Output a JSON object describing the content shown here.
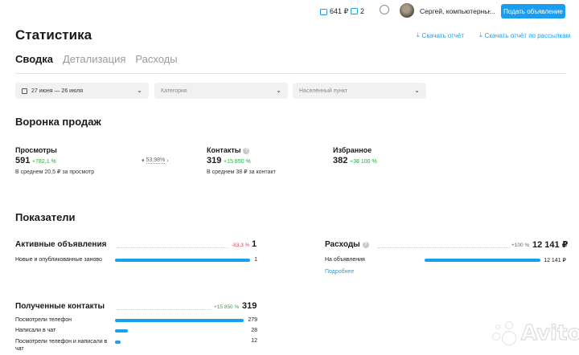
{
  "header": {
    "wallet_amount": "641 ₽",
    "messages_count": "2",
    "username": "Сергей, компьютерны...",
    "post_button": "Подать объявление",
    "icons": {
      "wallet": "wallet-icon",
      "messages": "chat-icon",
      "profile": "user-icon",
      "menu": "chevron-down-icon"
    }
  },
  "page": {
    "title": "Статистика",
    "download_report": "Скачать отчёт",
    "download_by_mailing": "Скачать отчёт по рассылкам"
  },
  "tabs": [
    {
      "label": "Сводка",
      "active": true
    },
    {
      "label": "Детализация",
      "active": false
    },
    {
      "label": "Расходы",
      "active": false
    }
  ],
  "filters": {
    "date_range": "27 июня — 26 июля",
    "category_placeholder": "Категория",
    "location_placeholder": "Населённый пункт"
  },
  "funnel": {
    "title": "Воронка продаж",
    "views": {
      "label": "Просмотры",
      "value": "591",
      "delta": "+782,1 %",
      "sub": "В среднем 20,5 ₽ за просмотр"
    },
    "conversion": "53,98%",
    "contacts": {
      "label": "Контакты",
      "value": "319",
      "delta": "+15 850 %",
      "sub": "В среднем 38 ₽ за контакт"
    },
    "favorites": {
      "label": "Избранное",
      "value": "382",
      "delta": "+38 100 %"
    }
  },
  "metrics": {
    "title": "Показатели",
    "active_ads": {
      "title": "Активные объявления",
      "delta": "-83,3 %",
      "value": "1",
      "rows": [
        {
          "label": "Новые и опубликованные заново",
          "value": "1",
          "fraction": 1.0
        }
      ]
    },
    "expenses": {
      "title": "Расходы",
      "delta": "+100 %",
      "value": "12 141 ₽",
      "rows": [
        {
          "label": "На объявления",
          "value": "12 141 ₽",
          "fraction": 1.0
        }
      ],
      "more_link": "Подробнее"
    },
    "contacts_received": {
      "title": "Полученные контакты",
      "delta": "+15 850 %",
      "value": "319",
      "rows": [
        {
          "label": "Посмотрели телефон",
          "value": "279",
          "fraction": 1.0
        },
        {
          "label": "Написали в чат",
          "value": "28",
          "fraction": 0.1
        },
        {
          "label": "Посмотрели телефон и написали в чат",
          "value": "12",
          "fraction": 0.043
        }
      ]
    }
  },
  "watermark": "Avito"
}
